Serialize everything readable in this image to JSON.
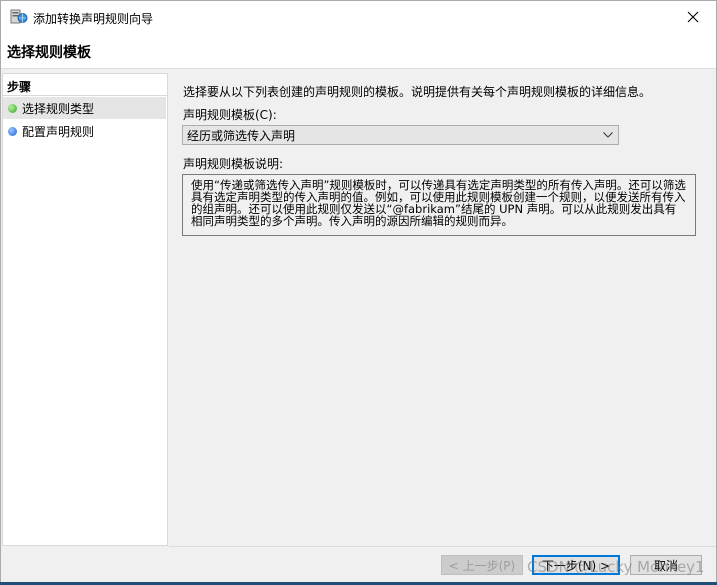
{
  "window": {
    "title": "添加转换声明规则向导",
    "app_icon": "server-icon",
    "close_icon": "close-icon"
  },
  "header": {
    "page_title": "选择规则模板"
  },
  "sidebar": {
    "heading": "步骤",
    "items": [
      {
        "label": "选择规则类型",
        "status": "current",
        "dot_color": "#2fa52b"
      },
      {
        "label": "配置声明规则",
        "status": "pending",
        "dot_color": "#1f5fd6"
      }
    ]
  },
  "main": {
    "intro": "选择要从以下列表创建的声明规则的模板。说明提供有关每个声明规则模板的详细信息。",
    "template_label": "声明规则模板(C):",
    "template_value": "经历或筛选传入声明",
    "description_label": "声明规则模板说明:",
    "description": "使用“传递或筛选传入声明”规则模板时，可以传递具有选定声明类型的所有传入声明。还可以筛选具有选定声明类型的传入声明的值。例如，可以使用此规则模板创建一个规则，以便发送所有传入的组声明。还可以使用此规则仅发送以“@fabrikam”结尾的 UPN 声明。可以从此规则发出具有相同声明类型的多个声明。传入声明的源因所编辑的规则而异。"
  },
  "footer": {
    "back_label": "< 上一步(P)",
    "next_label": "下一步(N) >",
    "cancel_label": "取消",
    "watermark": "CSDN @Lucky Monkey1"
  },
  "colors": {
    "accent": "#0078d7",
    "window_bg": "#f0f0f0"
  }
}
